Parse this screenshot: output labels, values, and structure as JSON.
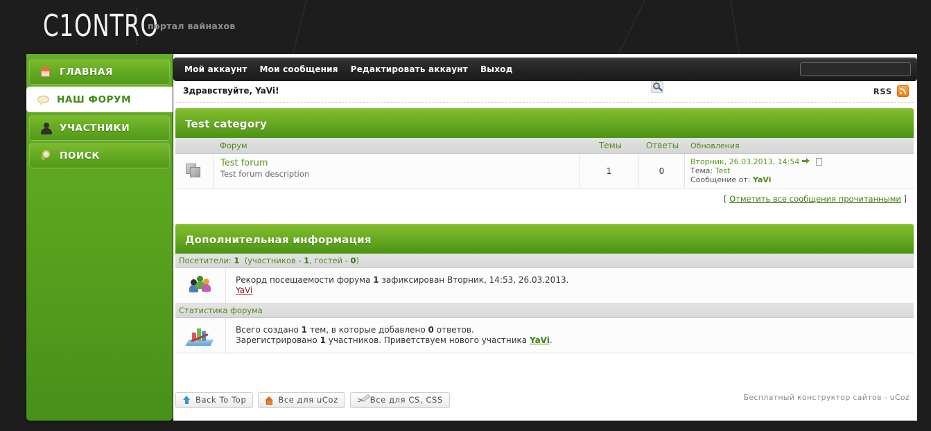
{
  "header": {
    "logo": "C1ONTRO",
    "tagline": "портал вайнахов"
  },
  "sidebar": {
    "items": [
      {
        "label": "ГЛАВНАЯ",
        "icon": "home-icon",
        "active": false
      },
      {
        "label": "НАШ ФОРУМ",
        "icon": "speech-bubble-icon",
        "active": true
      },
      {
        "label": "УЧАСТНИКИ",
        "icon": "user-icon",
        "active": false
      },
      {
        "label": "ПОИСК",
        "icon": "magnifier-icon",
        "active": false
      }
    ]
  },
  "topnav": {
    "items": [
      {
        "label": "Мой аккаунт"
      },
      {
        "label": "Мои сообщения"
      },
      {
        "label": "Редактировать аккаунт"
      },
      {
        "label": "Выход"
      }
    ],
    "search": {
      "value": "",
      "placeholder": ""
    },
    "search_button_icon": "search-icon"
  },
  "greeting": "Здравствуйте, YaVi!",
  "rss": {
    "label": "RSS",
    "icon": "rss-icon"
  },
  "category": {
    "title": "Test category",
    "columns": {
      "forum": "Форум",
      "topics": "Темы",
      "answers": "Ответы",
      "updates": "Обновления"
    },
    "rows": [
      {
        "icon": "folder-stack-icon",
        "name": "Test forum",
        "description": "Test forum description",
        "topics": "1",
        "answers": "0",
        "update_date": "Вторник, 26.03.2013, 14:54",
        "update_topic_label": "Тема:",
        "update_topic": "Test",
        "update_author_label": "Сообщение от:",
        "update_author": "YaVi"
      }
    ],
    "mark_read": {
      "bracket_open": "[",
      "label": "Отметить все сообщения прочитанными",
      "bracket_close": "]"
    }
  },
  "extra": {
    "title": "Дополнительная информация",
    "visitors": {
      "prefix": "Посетители:",
      "count": "1",
      "detail_open": "(участников -",
      "members": "1",
      "detail_mid": ", гостей -",
      "guests": "0",
      "detail_close": ")"
    },
    "record": {
      "icon": "people-icon",
      "text_before": "Рекорд посещаемости форума",
      "value": "1",
      "text_after": "зафиксирован Вторник, 14:53, 26.03.2013.",
      "user": "YaVi"
    },
    "stats_title": "Статистика форума",
    "stats": {
      "icon": "chart-icon",
      "line1_a": "Всего создано",
      "topics": "1",
      "line1_b": "тем, в которые добавлено",
      "answers": "0",
      "line1_c": "ответов.",
      "line2_a": "Зарегистрировано",
      "members": "1",
      "line2_b": "участников. Приветствуем нового участника",
      "new_member": "YaVi",
      "line2_c": "."
    }
  },
  "footer": {
    "buttons": [
      {
        "label": "Back To Top",
        "icon": "arrow-up-icon"
      },
      {
        "label": "Все для uCoz",
        "icon": "house-icon"
      },
      {
        "label": "Все для CS, CSS",
        "icon": "pencil-icon",
        "prefix": ">"
      }
    ],
    "credit": "Бесплатный конструктор сайтов - uCoz"
  },
  "colors": {
    "accent_green": "#5a9c23",
    "header_green_top": "#82bb2e",
    "header_green_bottom": "#4a9214",
    "dark": "#1d1d1d",
    "rss_orange": "#f07d11"
  }
}
